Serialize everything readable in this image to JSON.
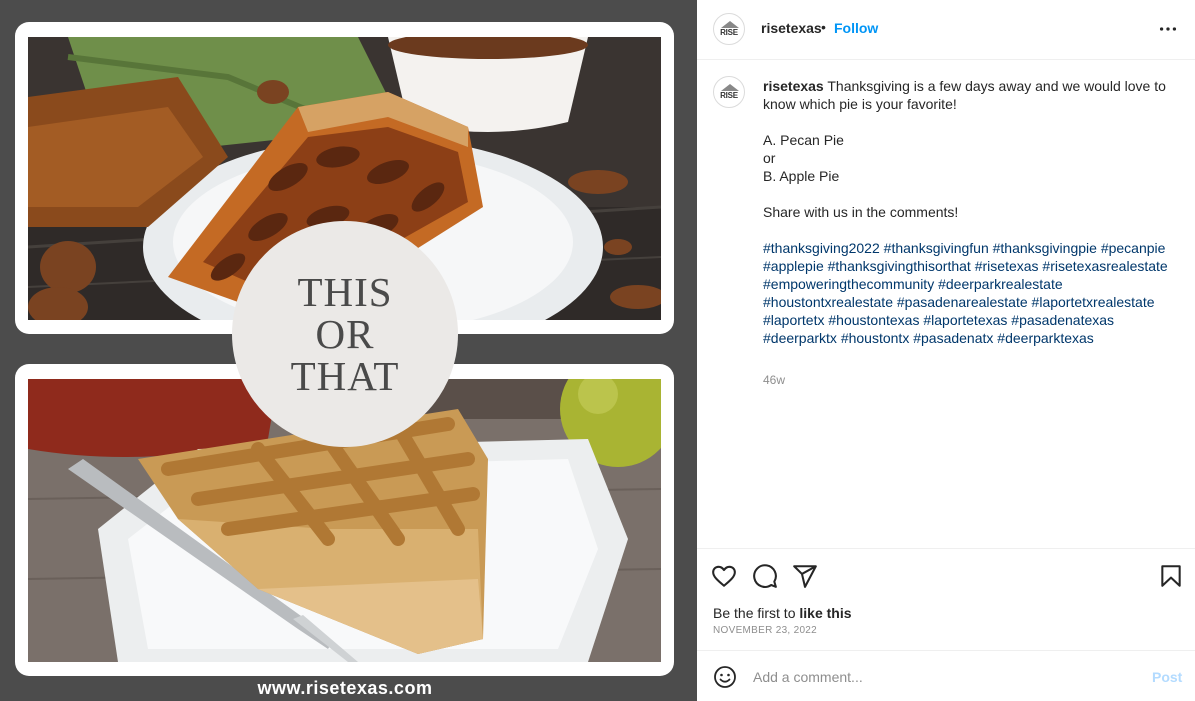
{
  "media": {
    "overlay_lines": [
      "THIS",
      "OR",
      "THAT"
    ],
    "site_url": "www.risetexas.com"
  },
  "account": {
    "username": "risetexas",
    "avatar_text": "RISE",
    "follow_label": "Follow",
    "separator": "•"
  },
  "caption": {
    "username": "risetexas",
    "intro": "Thanksgiving is a few days away and we would love to know which pie is your favorite!",
    "option_a": "A. Pecan Pie",
    "or_text": "or",
    "option_b": "B. Apple Pie",
    "share": "Share with us in the comments!",
    "hashtags": [
      "#thanksgiving2022",
      "#thanksgivingfun",
      "#thanksgivingpie",
      "#pecanpie",
      "#applepie",
      "#thanksgivingthisorthat",
      "#risetexas",
      "#risetexasrealestate",
      "#empoweringthecommunity",
      "#deerparkrealestate",
      "#houstontxrealestate",
      "#pasadenarealestate",
      "#laportetxrealestate",
      "#laportetx",
      "#houstontexas",
      "#laportetexas",
      "#pasadenatexas",
      "#deerparktx",
      "#houstontx",
      "#pasadenatx",
      "#deerparktexas"
    ],
    "age": "46w"
  },
  "actions": {
    "icons": [
      "heart-icon",
      "comment-icon",
      "share-icon",
      "bookmark-icon"
    ]
  },
  "likes": {
    "prefix": "Be the first to",
    "link": "like this"
  },
  "post_date": "NOVEMBER 23, 2022",
  "comment": {
    "placeholder": "Add a comment...",
    "post_label": "Post"
  },
  "colors": {
    "accent": "#0095f6",
    "hashtag": "#00376b",
    "media_bg": "#4c4c4c",
    "post_disabled": "#b3dbff"
  }
}
